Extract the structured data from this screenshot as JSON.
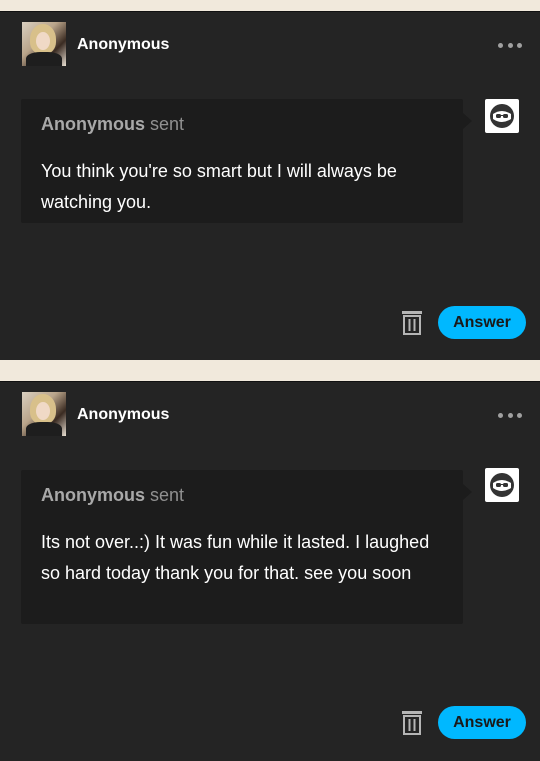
{
  "posts": [
    {
      "username": "Anonymous",
      "sender": "Anonymous",
      "sent_label": "sent",
      "message": "You think you're so smart but I will always be watching you.",
      "answer_label": "Answer",
      "avatar_icon": "user-avatar",
      "anon_icon": "anonymous-sunglasses-icon"
    },
    {
      "username": "Anonymous",
      "sender": "Anonymous",
      "sent_label": "sent",
      "message": "Its not over..:) It was fun while it lasted. I laughed so hard today thank you for that. see you soon",
      "answer_label": "Answer",
      "avatar_icon": "user-avatar",
      "anon_icon": "anonymous-sunglasses-icon"
    }
  ],
  "colors": {
    "page_background": "#f1e9dc",
    "card_background": "#242424",
    "bubble_background": "#1c1c1c",
    "answer_button": "#00b8ff"
  }
}
